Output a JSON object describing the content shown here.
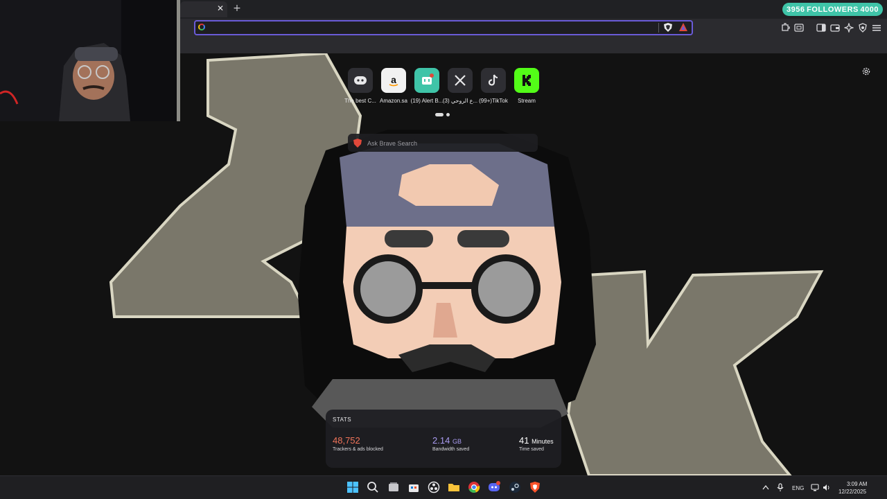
{
  "overlay": {
    "followers_current": "3956",
    "followers_label": "FOLLOWERS",
    "followers_goal": "4000"
  },
  "browser": {
    "tab_close_glyph": "✕",
    "new_tab_glyph": "+",
    "address_value": "",
    "accent": "#6a5bd8"
  },
  "shortcuts": [
    {
      "label": "The best C...",
      "icon": "game-controller-icon"
    },
    {
      "label": "Amazon.sa",
      "icon": "amazon-icon"
    },
    {
      "label": "(19) Alert B...",
      "icon": "alert-box-icon"
    },
    {
      "label": "(3) ع الروحي...",
      "icon": "x-icon"
    },
    {
      "label": "(99+)TikTok",
      "icon": "tiktok-icon"
    },
    {
      "label": "Stream",
      "icon": "kick-icon"
    }
  ],
  "search": {
    "placeholder": "Ask Brave Search"
  },
  "stats": {
    "title": "STATS",
    "trackers_value": "48,752",
    "trackers_label": "Trackers & ads blocked",
    "bandwidth_value": "2.14",
    "bandwidth_unit": "GB",
    "bandwidth_label": "Bandwidth saved",
    "time_value": "41",
    "time_unit": "Minutes",
    "time_label": "Time saved",
    "colors": {
      "trackers": "#f0745a",
      "bandwidth": "#a99bf0",
      "time": "#ffffff"
    }
  },
  "taskbar": {
    "language": "ENG",
    "time": "3:09 AM",
    "date": "12/22/2025",
    "apps": [
      "windows-start-icon",
      "search-icon",
      "task-view-icon",
      "store-icon",
      "obs-icon",
      "file-explorer-icon",
      "chrome-icon",
      "discord-icon",
      "steam-icon",
      "brave-icon"
    ]
  }
}
